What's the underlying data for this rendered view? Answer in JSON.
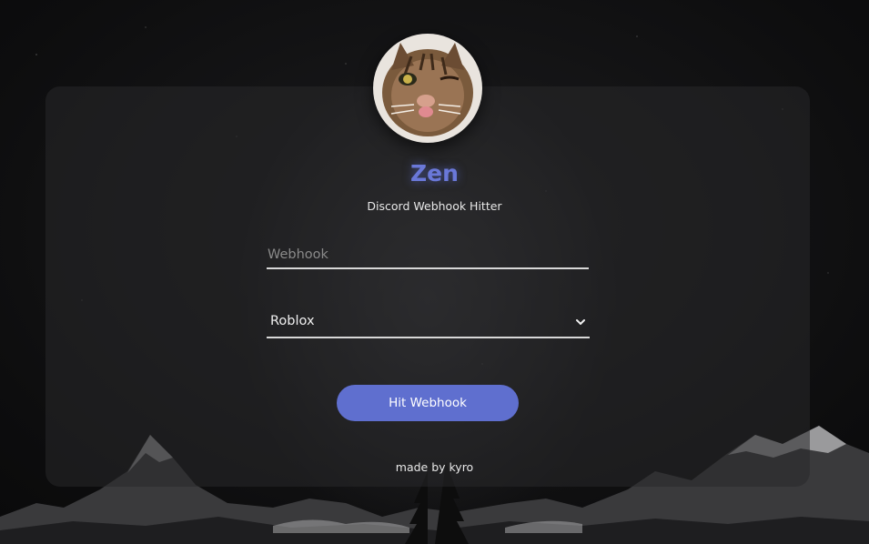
{
  "profile": {
    "name": "Zen",
    "subtitle": "Discord Webhook Hitter",
    "avatar_icon": "cat-face-avatar"
  },
  "form": {
    "webhook": {
      "placeholder": "Webhook",
      "value": ""
    },
    "platform": {
      "selected": "Roblox"
    },
    "submit_label": "Hit Webhook"
  },
  "footer": {
    "text": "made by kyro"
  },
  "colors": {
    "accent": "#5f6fcf",
    "title": "#6a78d8"
  }
}
